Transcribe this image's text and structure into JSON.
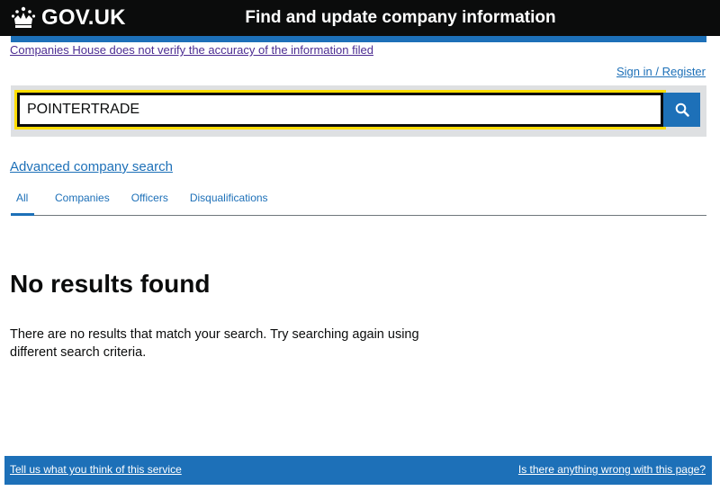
{
  "header": {
    "logo_text": "GOV.UK",
    "service_name": "Find and update company information"
  },
  "disclaimer": "Companies House does not verify the accuracy of the information filed",
  "sign_in": "Sign in / Register",
  "search": {
    "value": "POINTERTRADE",
    "button_icon": "search-icon"
  },
  "advanced_search": "Advanced company search",
  "tabs": [
    {
      "label": "All",
      "active": true
    },
    {
      "label": "Companies",
      "active": false
    },
    {
      "label": "Officers",
      "active": false
    },
    {
      "label": "Disqualifications",
      "active": false
    }
  ],
  "results": {
    "title": "No results found",
    "message": "There are no results that match your search. Try searching again using different search criteria."
  },
  "footer": {
    "feedback": "Tell us what you think of this service",
    "report": "Is there anything wrong with this page?"
  },
  "colors": {
    "header_bg": "#0b0c0c",
    "brand_blue": "#1d70b8",
    "focus_yellow": "#ffdd00",
    "visited_link": "#4c2c92",
    "panel_grey": "#dee0e2"
  }
}
